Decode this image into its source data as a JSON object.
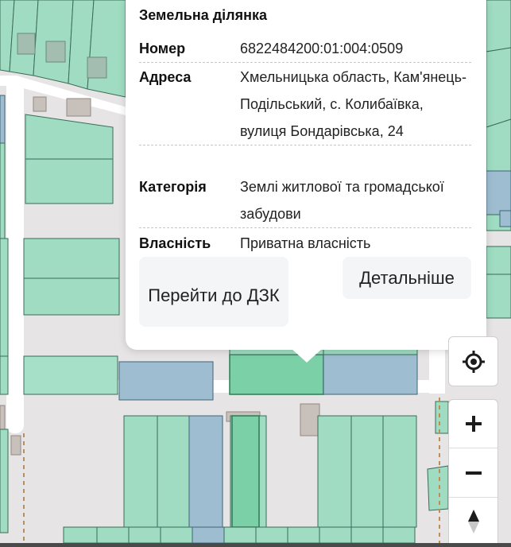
{
  "popup": {
    "title": "Земельна ділянка",
    "rows": [
      {
        "label": "Номер",
        "value": "6822484200:01:004:0509"
      },
      {
        "label": "Адреса",
        "value": "Хмельницька область, Кам'янець-Подільський, с. Колибаївка, вулиця Бондарівська, 24"
      },
      {
        "label": "Категорія",
        "value": "Землі житлової та громадської забудови"
      },
      {
        "label": "Власність",
        "value": "Приватна власність"
      }
    ],
    "buttons": {
      "dzk": "Перейти до ДЗК",
      "details": "Детальніше"
    }
  },
  "controls": {
    "locate": "crosshair-icon",
    "zoom_in": "plus-icon",
    "zoom_out": "minus-icon",
    "compass": "compass-icon"
  },
  "colors": {
    "parcel": "#9fdcc2",
    "parcel_selected": "#7bd0a8",
    "parcel_blue": "#9ebdd0",
    "background": "#e6e4e4",
    "road": "#ffffff"
  }
}
